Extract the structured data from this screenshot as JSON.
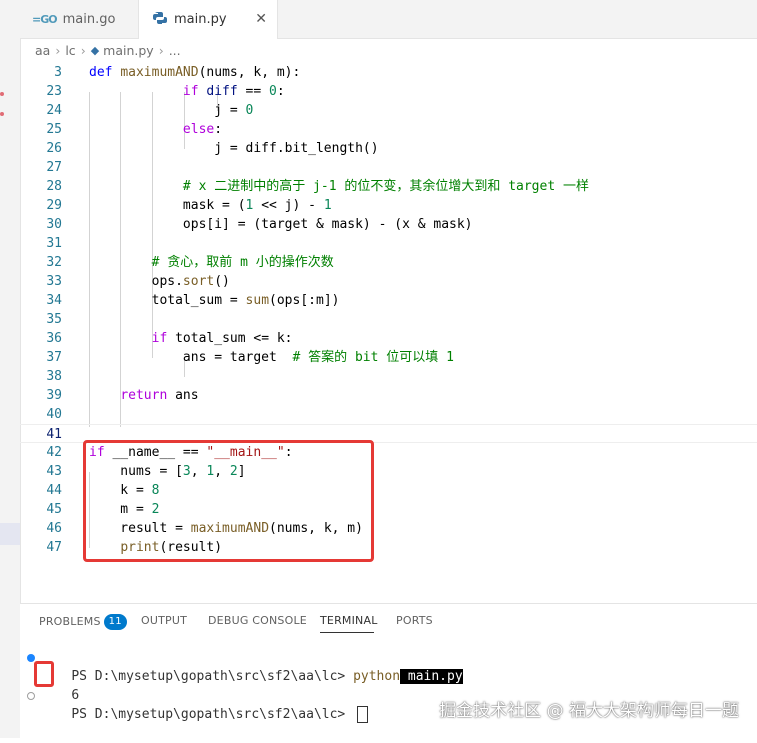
{
  "tabs": [
    {
      "label": "main.go",
      "icon": "go-file-icon",
      "active": false
    },
    {
      "label": "main.py",
      "icon": "python-file-icon",
      "active": true
    }
  ],
  "breadcrumb": {
    "parts": [
      "aa",
      "lc",
      "main.py",
      "..."
    ]
  },
  "editor": {
    "lines": [
      {
        "n": "3",
        "tokens": [
          [
            "kw",
            "def "
          ],
          [
            "fn",
            "maximumAND"
          ],
          [
            "",
            "(nums, k, m):"
          ]
        ]
      },
      {
        "n": "23",
        "tokens": [
          [
            "",
            "            "
          ],
          [
            "kwc",
            "if"
          ],
          [
            "var",
            " diff"
          ],
          [
            "",
            " == "
          ],
          [
            "num",
            "0"
          ],
          [
            "",
            ":"
          ]
        ]
      },
      {
        "n": "24",
        "tokens": [
          [
            "",
            "                j = "
          ],
          [
            "num",
            "0"
          ]
        ]
      },
      {
        "n": "25",
        "tokens": [
          [
            "",
            "            "
          ],
          [
            "kwc",
            "else"
          ],
          [
            "",
            ":"
          ]
        ]
      },
      {
        "n": "26",
        "tokens": [
          [
            "",
            "                j = diff.bit_length()"
          ]
        ]
      },
      {
        "n": "27",
        "tokens": [
          [
            "",
            ""
          ]
        ]
      },
      {
        "n": "28",
        "tokens": [
          [
            "",
            "            "
          ],
          [
            "cm",
            "# x 二进制中的高于 j-1 的位不变，其余位增大到和 target 一样"
          ]
        ]
      },
      {
        "n": "29",
        "tokens": [
          [
            "",
            "            mask = ("
          ],
          [
            "num",
            "1"
          ],
          [
            "",
            " << j) - "
          ],
          [
            "num",
            "1"
          ]
        ]
      },
      {
        "n": "30",
        "tokens": [
          [
            "",
            "            ops[i] = (target & mask) - (x & mask)"
          ]
        ]
      },
      {
        "n": "31",
        "tokens": [
          [
            "",
            ""
          ]
        ]
      },
      {
        "n": "32",
        "tokens": [
          [
            "",
            "        "
          ],
          [
            "cm",
            "# 贪心，取前 m 小的操作次数"
          ]
        ]
      },
      {
        "n": "33",
        "tokens": [
          [
            "",
            "        ops."
          ],
          [
            "fn",
            "sort"
          ],
          [
            "",
            "()"
          ]
        ]
      },
      {
        "n": "34",
        "tokens": [
          [
            "",
            "        total_sum = "
          ],
          [
            "fn",
            "sum"
          ],
          [
            "",
            "(ops[:m])"
          ]
        ]
      },
      {
        "n": "35",
        "tokens": [
          [
            "",
            ""
          ]
        ]
      },
      {
        "n": "36",
        "tokens": [
          [
            "",
            "        "
          ],
          [
            "kwc",
            "if"
          ],
          [
            "",
            " total_sum <= k:"
          ]
        ]
      },
      {
        "n": "37",
        "tokens": [
          [
            "",
            "            ans = target  "
          ],
          [
            "cm",
            "# 答案的 bit 位可以填 1"
          ]
        ]
      },
      {
        "n": "38",
        "tokens": [
          [
            "",
            ""
          ]
        ]
      },
      {
        "n": "39",
        "tokens": [
          [
            "",
            "    "
          ],
          [
            "kwc",
            "return"
          ],
          [
            "",
            " ans"
          ]
        ]
      },
      {
        "n": "40",
        "tokens": [
          [
            "",
            ""
          ]
        ]
      },
      {
        "n": "41",
        "tokens": [
          [
            "",
            ""
          ]
        ]
      },
      {
        "n": "42",
        "tokens": [
          [
            "kwc",
            "if"
          ],
          [
            "",
            " __name__ == "
          ],
          [
            "str",
            "\"__main__\""
          ],
          [
            "",
            ":"
          ]
        ]
      },
      {
        "n": "43",
        "tokens": [
          [
            "",
            "    nums = ["
          ],
          [
            "num",
            "3"
          ],
          [
            "",
            ", "
          ],
          [
            "num",
            "1"
          ],
          [
            "",
            ", "
          ],
          [
            "num",
            "2"
          ],
          [
            "",
            "]"
          ]
        ]
      },
      {
        "n": "44",
        "tokens": [
          [
            "",
            "    k = "
          ],
          [
            "num",
            "8"
          ]
        ]
      },
      {
        "n": "45",
        "tokens": [
          [
            "",
            "    m = "
          ],
          [
            "num",
            "2"
          ]
        ]
      },
      {
        "n": "46",
        "tokens": [
          [
            "",
            "    result = "
          ],
          [
            "fn",
            "maximumAND"
          ],
          [
            "",
            "(nums, k, m)"
          ]
        ]
      },
      {
        "n": "47",
        "tokens": [
          [
            "",
            "    "
          ],
          [
            "fn",
            "print"
          ],
          [
            "",
            "(result)"
          ]
        ]
      }
    ]
  },
  "panel": {
    "tabs": [
      {
        "label": "PROBLEMS",
        "badge": "11"
      },
      {
        "label": "OUTPUT"
      },
      {
        "label": "DEBUG CONSOLE"
      },
      {
        "label": "TERMINAL",
        "active": true
      },
      {
        "label": "PORTS"
      }
    ],
    "terminal": {
      "prompt": "PS D:\\mysetup\\gopath\\src\\sf2\\aa\\lc> ",
      "command": "python",
      "arg": " main.py",
      "output": "6"
    }
  },
  "watermark": "掘金技术社区 @ 福大大架构师每日一题"
}
